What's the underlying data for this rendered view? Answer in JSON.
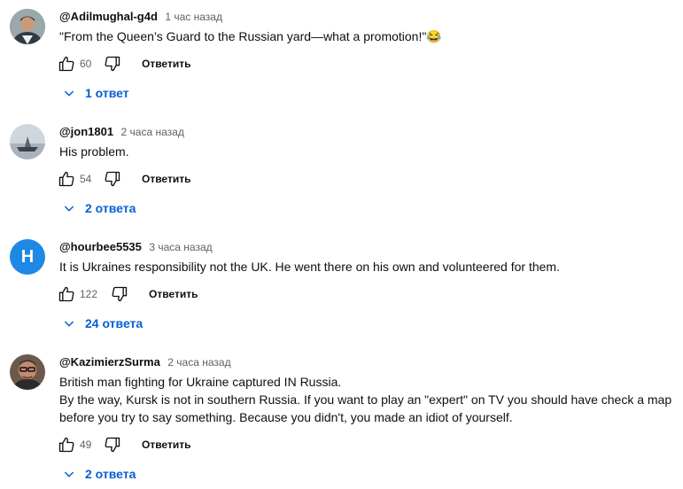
{
  "comments": [
    {
      "author": "@Adilmughal-g4d",
      "time": "1 час назад",
      "lines": [
        "\"From the Queen’s Guard to the Russian yard—what a promotion!\"😂"
      ],
      "likes": "60",
      "reply_label": "Ответить",
      "replies_label": "1 ответ",
      "avatar": "photo-man-suit"
    },
    {
      "author": "@jon1801",
      "time": "2 часа назад",
      "lines": [
        "His problem."
      ],
      "likes": "54",
      "reply_label": "Ответить",
      "replies_label": "2 ответа",
      "avatar": "photo-boat-water"
    },
    {
      "author": "@hourbee5535",
      "time": "3 часа назад",
      "lines": [
        "It is Ukraines responsibility not the UK. He went there on his own and volunteered for them."
      ],
      "likes": "122",
      "reply_label": "Ответить",
      "replies_label": "24 ответа",
      "avatar": "H",
      "avatar_color": "#1e88e5"
    },
    {
      "author": "@KazimierzSurma",
      "time": "2 часа назад",
      "lines": [
        "British man fighting for Ukraine captured IN Russia.",
        "By the way, Kursk is not in southern Russia. If you want to play an \"expert\" on TV you should have check a map",
        "before you try to say something. Because you didn't, you made an idiot of yourself."
      ],
      "likes": "49",
      "reply_label": "Ответить",
      "replies_label": "2 ответа",
      "avatar": "photo-man-glasses"
    }
  ],
  "icons": {
    "like": "thumbs-up-icon",
    "dislike": "thumbs-down-icon",
    "expand": "chevron-down-icon"
  },
  "colors": {
    "link_blue": "#065fd4",
    "secondary_text": "#606060"
  }
}
